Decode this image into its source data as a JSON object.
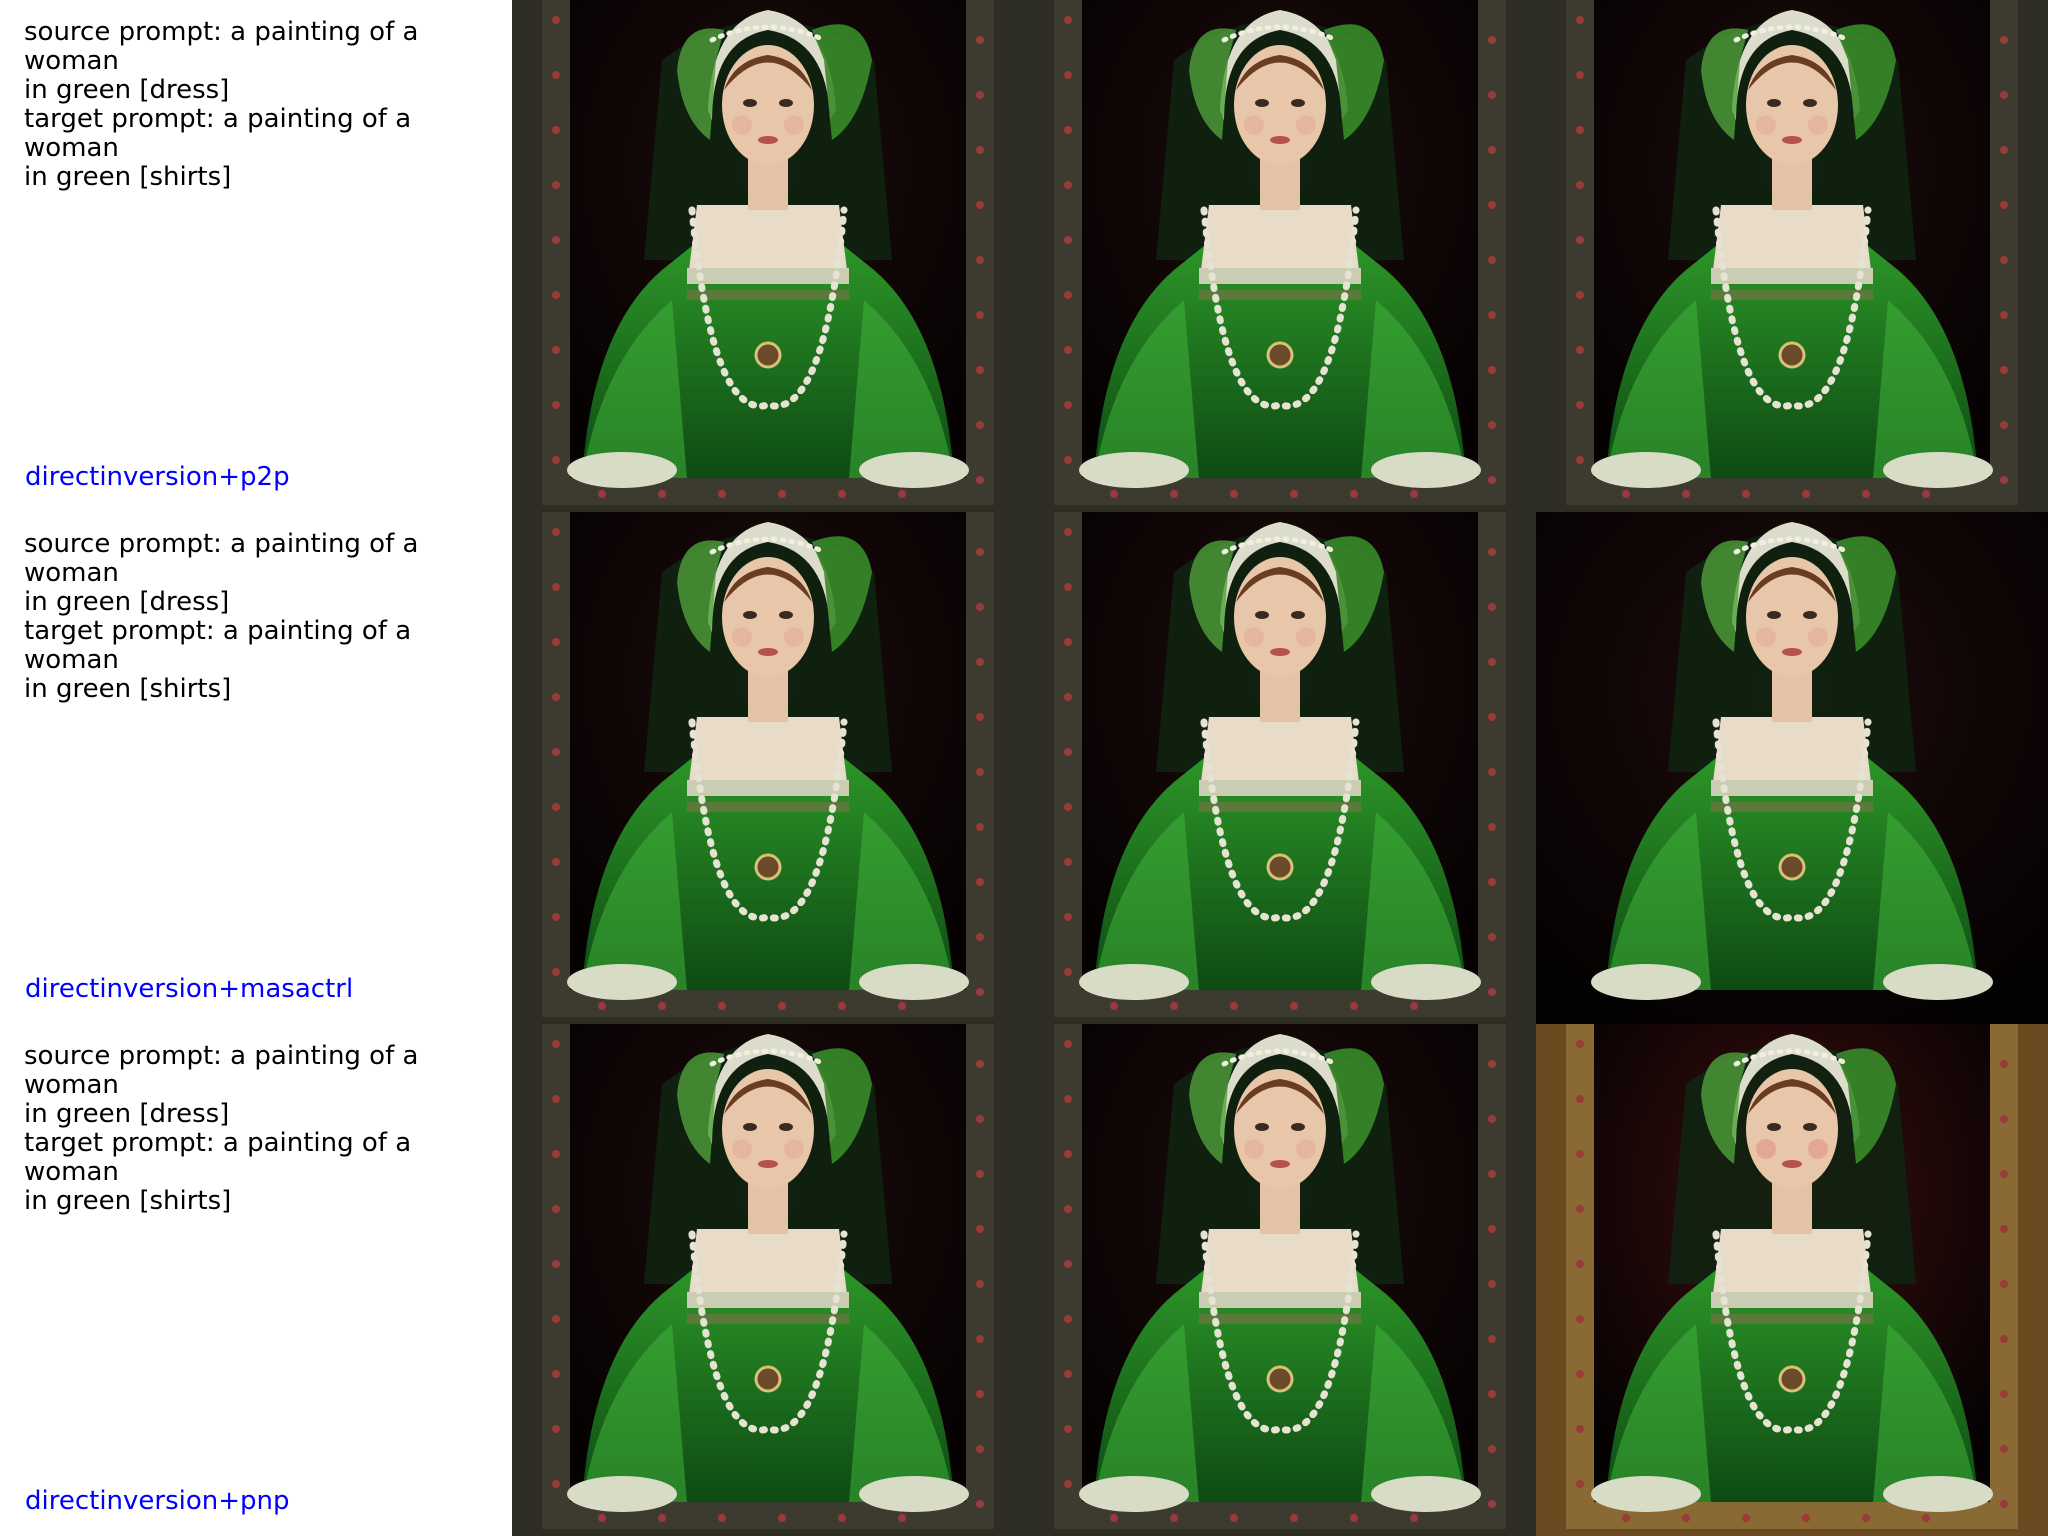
{
  "rows": [
    {
      "source_prompt": "source prompt: a painting of a woman\nin green [dress]",
      "target_prompt": "target prompt: a painting of a woman\nin green [shirts]",
      "method": "directinversion+p2p",
      "tiles": [
        "framed-portrait",
        "framed-portrait",
        "framed-portrait"
      ]
    },
    {
      "source_prompt": "source prompt: a painting of a woman\nin green [dress]",
      "target_prompt": "target prompt: a painting of a woman\nin green [shirts]",
      "method": "directinversion+masactrl",
      "tiles": [
        "framed-portrait",
        "framed-portrait",
        "unframed-portrait"
      ]
    },
    {
      "source_prompt": "source prompt: a painting of a woman\nin green [dress]",
      "target_prompt": "target prompt: a painting of a woman\nin green [shirts]",
      "method": "directinversion+pnp",
      "tiles": [
        "framed-portrait",
        "framed-portrait",
        "golden-framed-portrait"
      ]
    }
  ],
  "colors": {
    "method_label": "#0000ff",
    "prompt_text": "#000000",
    "dress_green": "#1f7a1f",
    "background_dark": "#120606",
    "frame_dark": "#2b2a22"
  }
}
